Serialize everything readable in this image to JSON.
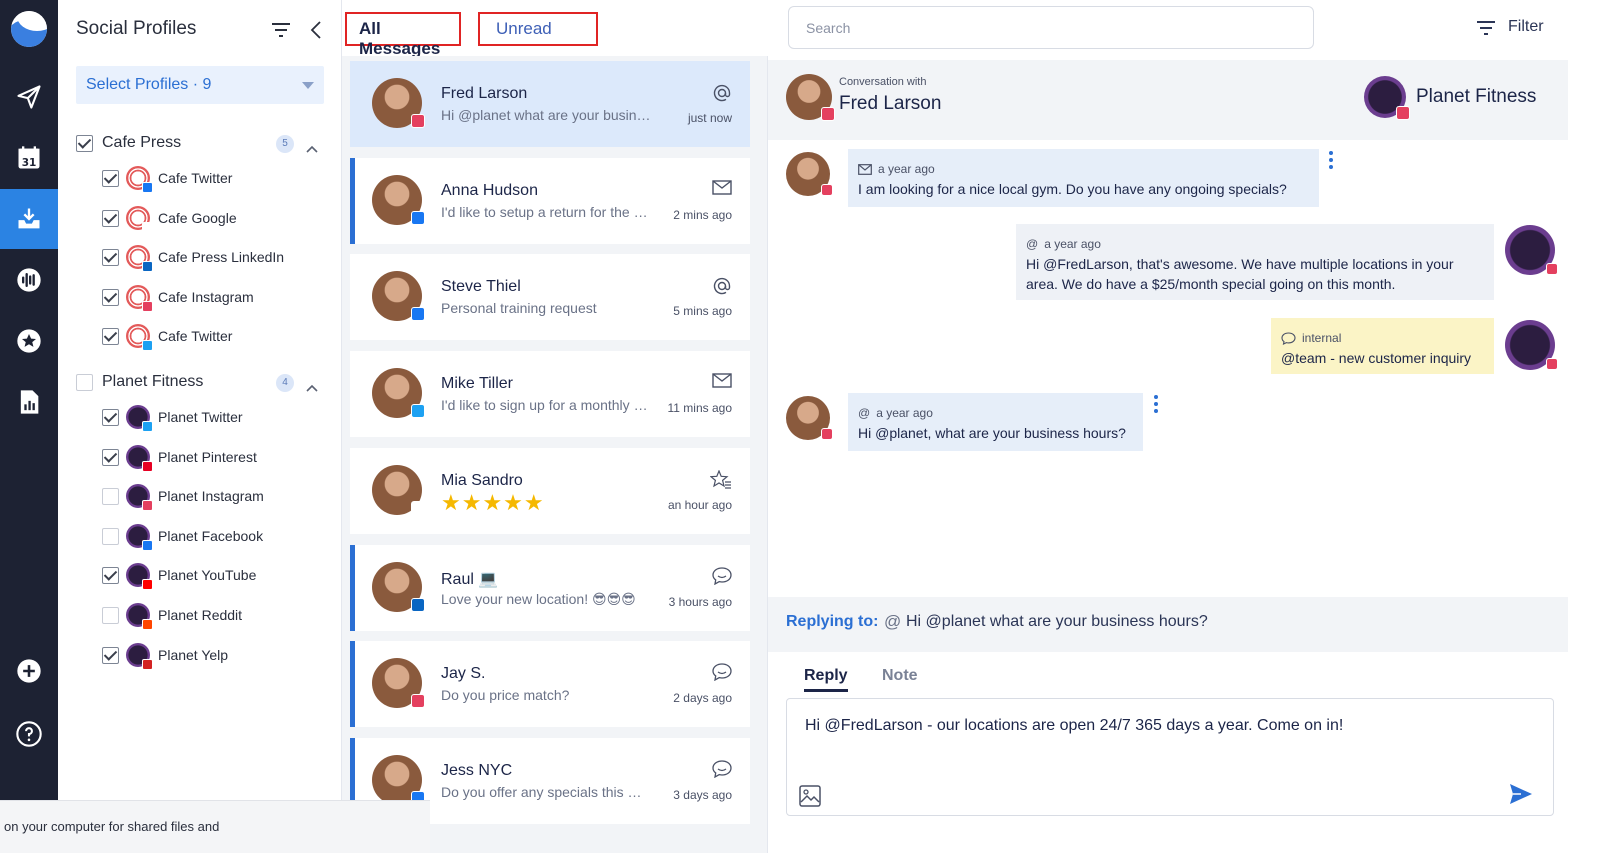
{
  "colors": {
    "accent": "#2b6fd3",
    "rail_bg": "#1d2233",
    "highlight": "#e02424",
    "note_bg": "#fbf4c6",
    "star": "#f5b800"
  },
  "rail": {
    "icons": [
      "send-icon",
      "calendar-icon",
      "inbox-icon",
      "audio-wave-icon",
      "star-icon",
      "report-icon",
      "add-icon",
      "help-icon"
    ],
    "calendar_day": "31",
    "active": "inbox-icon"
  },
  "profiles": {
    "title": "Social Profiles",
    "select_label": "Select Profiles · 9",
    "groups": [
      {
        "name": "Cafe Press",
        "count": "5",
        "checked": true,
        "items": [
          {
            "label": "Cafe Twitter",
            "checked": true,
            "network": "facebook"
          },
          {
            "label": "Cafe Google",
            "checked": true,
            "network": "google"
          },
          {
            "label": "Cafe Press LinkedIn",
            "checked": true,
            "network": "linkedin"
          },
          {
            "label": "Cafe Instagram",
            "checked": true,
            "network": "instagram"
          },
          {
            "label": "Cafe Twitter",
            "checked": true,
            "network": "twitter"
          }
        ]
      },
      {
        "name": "Planet Fitness",
        "count": "4",
        "checked": false,
        "items": [
          {
            "label": "Planet Twitter",
            "checked": true,
            "network": "twitter"
          },
          {
            "label": "Planet Pinterest",
            "checked": true,
            "network": "pinterest"
          },
          {
            "label": "Planet Instagram",
            "checked": false,
            "network": "instagram"
          },
          {
            "label": "Planet Facebook",
            "checked": false,
            "network": "facebook"
          },
          {
            "label": "Planet YouTube",
            "checked": true,
            "network": "youtube"
          },
          {
            "label": "Planet Reddit",
            "checked": false,
            "network": "reddit"
          },
          {
            "label": "Planet Yelp",
            "checked": true,
            "network": "yelp"
          }
        ]
      }
    ]
  },
  "tabs": {
    "all": "All Messages",
    "unread": "Unread"
  },
  "messages": [
    {
      "name": "Fred Larson",
      "preview": "Hi @planet what are your business hours?",
      "time": "just now",
      "icon": "at-icon",
      "network": "instagram",
      "selected": true,
      "unread": false
    },
    {
      "name": "Anna Hudson",
      "preview": "I'd like to setup a return for the order I placed",
      "time": "2 mins ago",
      "icon": "mail-icon",
      "network": "facebook",
      "selected": false,
      "unread": true
    },
    {
      "name": "Steve Thiel",
      "preview": "Personal training request",
      "time": "5 mins ago",
      "icon": "at-icon",
      "network": "facebook",
      "selected": false,
      "unread": false
    },
    {
      "name": "Mike Tiller",
      "preview": "I'd like to sign up for a monthly membership",
      "time": "11 mins ago",
      "icon": "mail-icon",
      "network": "twitter",
      "selected": false,
      "unread": false
    },
    {
      "name": "Mia Sandro",
      "preview": "",
      "stars": "★★★★★",
      "rating": 5,
      "time": "an hour ago",
      "icon": "star-review-icon",
      "network": "google",
      "selected": false,
      "unread": false
    },
    {
      "name": "Raul 💻",
      "preview": "Love your new location! 😎😎😎",
      "time": "3 hours ago",
      "icon": "chat-icon",
      "network": "linkedin",
      "selected": false,
      "unread": true
    },
    {
      "name": "Jay S.",
      "preview": "Do you price match?",
      "time": "2 days ago",
      "icon": "chat-icon",
      "network": "instagram",
      "selected": false,
      "unread": true
    },
    {
      "name": "Jess NYC",
      "preview": "Do you offer any specials this month?",
      "time": "3 days ago",
      "icon": "chat-icon",
      "network": "facebook",
      "selected": false,
      "unread": true
    }
  ],
  "search": {
    "placeholder": "Search",
    "value": ""
  },
  "filter_label": "Filter",
  "conversation": {
    "with_label": "Conversation with",
    "contact": "Fred Larson",
    "brand": "Planet Fitness",
    "brand_logo_text": "Planet Fitness",
    "thread": [
      {
        "side": "in",
        "kind": "mail",
        "time": "a year ago",
        "text": "I am looking for a nice local gym. Do you have any ongoing specials?"
      },
      {
        "side": "out",
        "kind": "at",
        "time": "a year ago",
        "text": "Hi @FredLarson, that's awesome. We have multiple locations in your area. We do have a $25/month special going on this month."
      },
      {
        "side": "note",
        "kind": "internal",
        "time": "internal",
        "text": "@team - new customer inquiry"
      },
      {
        "side": "in",
        "kind": "at",
        "time": "a year ago",
        "text": "Hi @planet, what are your business hours?"
      }
    ],
    "replying_label": "Replying to:",
    "replying_text": "Hi @planet what are your business hours?",
    "reply_tab": "Reply",
    "note_tab": "Note",
    "draft": "Hi @FredLarson - our locations are open 24/7 365 days a year. Come on in!"
  },
  "toast": {
    "text": "on your computer for shared files and"
  }
}
